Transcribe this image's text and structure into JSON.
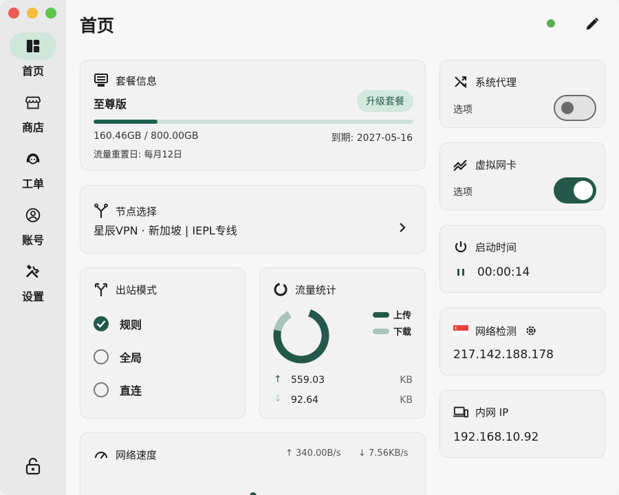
{
  "window": {
    "traffic_lights": [
      "close",
      "minimize",
      "zoom"
    ]
  },
  "sidebar": {
    "items": [
      {
        "label": "首页",
        "icon": "dashboard-icon",
        "active": true
      },
      {
        "label": "商店",
        "icon": "store-icon",
        "active": false
      },
      {
        "label": "工单",
        "icon": "support-agent-icon",
        "active": false
      },
      {
        "label": "账号",
        "icon": "account-circle-icon",
        "active": false
      },
      {
        "label": "设置",
        "icon": "tools-icon",
        "active": false
      }
    ],
    "lock_icon": "lock-icon"
  },
  "header": {
    "title": "首页",
    "status_color": "#5aad4e"
  },
  "plan": {
    "title": "套餐信息",
    "name": "至尊版",
    "upgrade_label": "升级套餐",
    "usage": "160.46GB / 800.00GB",
    "usage_fraction": 0.2006,
    "expiry": "到期: 2027-05-16",
    "reset": "流量重置日: 每月12日"
  },
  "node": {
    "title": "节点选择",
    "value": "星辰VPN · 新加坡 | IEPL专线"
  },
  "outbound": {
    "title": "出站模式",
    "options": [
      {
        "label": "规则",
        "checked": true
      },
      {
        "label": "全局",
        "checked": false
      },
      {
        "label": "直连",
        "checked": false
      }
    ]
  },
  "traffic": {
    "title": "流量统计",
    "legend_upload": "上传",
    "legend_download": "下载",
    "upload_value": "559.03",
    "upload_unit": "KB",
    "download_value": "92.64",
    "download_unit": "KB",
    "upload_color": "#24594a",
    "download_color": "#a9c4b9"
  },
  "speed": {
    "title": "网络速度",
    "upload": "↑ 340.00B/s",
    "download": "↓ 7.56KB/s"
  },
  "system_proxy": {
    "title": "系统代理",
    "option_label": "选项",
    "enabled": false
  },
  "tun": {
    "title": "虚拟网卡",
    "option_label": "选项",
    "enabled": true
  },
  "uptime": {
    "title": "启动时间",
    "value": "00:00:14"
  },
  "network_check": {
    "title": "网络检测",
    "ip": "217.142.188.178",
    "flag": "singapore-flag-icon"
  },
  "lan_ip": {
    "title": "内网 IP",
    "ip": "192.168.10.92"
  },
  "colors": {
    "accent": "#24594a",
    "accent_light": "#cfe6dc"
  }
}
